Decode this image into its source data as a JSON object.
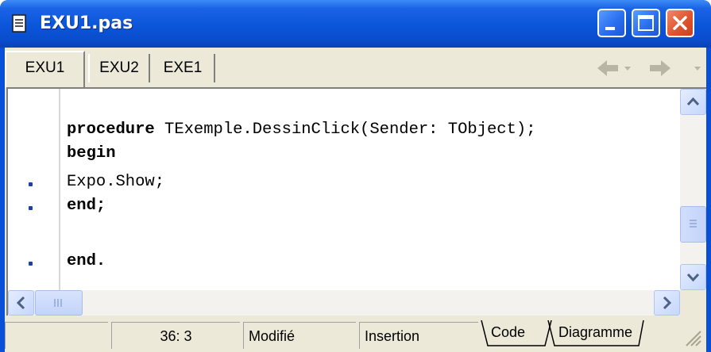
{
  "window": {
    "title": "EXU1.pas",
    "controls": {
      "minimize": "minimize",
      "maximize": "maximize",
      "close": "close"
    }
  },
  "tabs": [
    {
      "label": "EXU1",
      "active": true
    },
    {
      "label": "EXU2",
      "active": false
    },
    {
      "label": "EXE1",
      "active": false
    }
  ],
  "navigation": {
    "back_icon": "back-arrow-icon",
    "forward_icon": "forward-arrow-icon"
  },
  "editor": {
    "lines": [
      {
        "keyword": "procedure",
        "text": " TExemple.DessinClick(Sender: TObject);",
        "marker": false
      },
      {
        "keyword": "begin",
        "text": "",
        "marker": false
      },
      {
        "keyword": "",
        "text": "Expo.Show;",
        "marker": true
      },
      {
        "keyword": "end;",
        "text": "",
        "marker": true
      },
      {
        "keyword": "",
        "text": "",
        "marker": false
      },
      {
        "keyword": "end.",
        "text": "",
        "marker": true
      }
    ]
  },
  "status": {
    "position": "36:  3",
    "modified": "Modifié",
    "mode": "Insertion",
    "view_tabs": [
      "Code",
      "Diagramme"
    ]
  },
  "colors": {
    "titlebar": "#0a4fd8",
    "close_button": "#e05530",
    "marker": "#1d3fa8"
  }
}
